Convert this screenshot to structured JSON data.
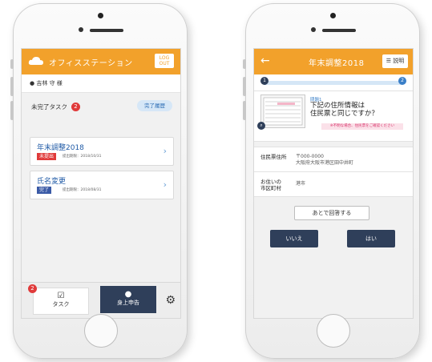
{
  "left_screen": {
    "app_title": "オフィスステーション",
    "logout_label_1": "LOG",
    "logout_label_2": "OUT",
    "user_name": "吉林 守 様",
    "incomplete_tasks_label": "未完了タスク",
    "incomplete_count": "2",
    "completed_history_label": "完了履歴",
    "tasks": [
      {
        "title": "年末調整2018",
        "status": "未提出",
        "status_color": "#e03a3a",
        "deadline": "提出期限：2018/10/31"
      },
      {
        "title": "氏名変更",
        "status": "完了",
        "status_color": "#3a5aa6",
        "deadline": "提出期限：2018/08/31"
      }
    ],
    "bottom_nav": {
      "task_label": "タスク",
      "task_badge": "2",
      "self_report_label": "身上申告"
    }
  },
  "right_screen": {
    "title": "年末調整2018",
    "help_label": "説明",
    "progress": {
      "current": "1",
      "total": "2",
      "fraction": 0.02
    },
    "question_number": "問題1",
    "question_line1": "下記の住所情報は",
    "question_line2": "住民票と同じですか？",
    "question_note": "※不明な場合、住民票をご確認ください",
    "info": [
      {
        "key": "住民票住所",
        "value_line1": "〒000-0000",
        "value_line2": "大阪府大阪市港区田中井町"
      },
      {
        "key_line1": "お住いの",
        "key_line2": "市区町村",
        "value_line1": "港市",
        "value_line2": ""
      }
    ],
    "later_label": "あとで回答する",
    "no_label": "いいえ",
    "yes_label": "はい"
  },
  "colors": {
    "accent": "#f2a12b",
    "navy": "#2f3f5a",
    "blue": "#3a7fc8"
  }
}
